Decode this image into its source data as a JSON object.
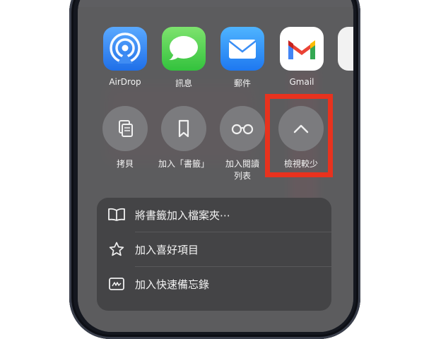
{
  "share_sheet": {
    "apps": [
      {
        "name": "AirDrop",
        "icon": "airdrop-icon"
      },
      {
        "name": "訊息",
        "icon": "messages-icon"
      },
      {
        "name": "郵件",
        "icon": "mail-icon"
      },
      {
        "name": "Gmail",
        "icon": "gmail-icon"
      }
    ],
    "actions": [
      {
        "label": "拷貝",
        "icon": "copy-icon"
      },
      {
        "label": "加入「書籤」",
        "icon": "bookmark-icon"
      },
      {
        "label_line1": "加入閱讀",
        "label_line2": "列表",
        "icon": "reading-list-icon"
      },
      {
        "label": "檢視較少",
        "icon": "chevron-up-icon"
      }
    ],
    "menu": [
      {
        "label": "將書籤加入檔案夾⋯",
        "icon": "book-icon"
      },
      {
        "label": "加入喜好項目",
        "icon": "star-icon"
      },
      {
        "label": "加入快速備忘錄",
        "icon": "quick-note-icon"
      }
    ]
  },
  "colors": {
    "highlight": "#e8321e",
    "sheet": "#5c5c5e",
    "menu": "#444446"
  }
}
